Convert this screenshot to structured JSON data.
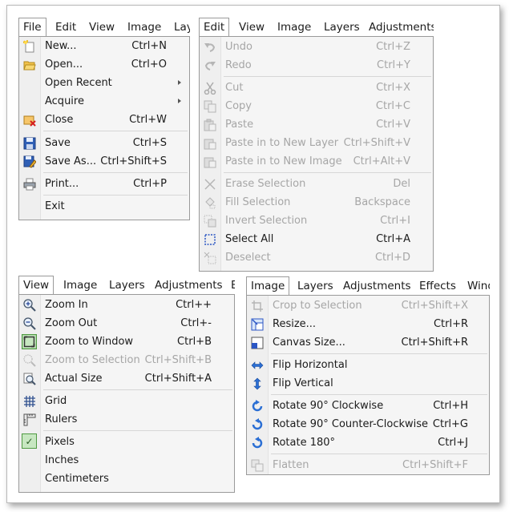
{
  "file_panel": {
    "menubar": [
      "File",
      "Edit",
      "View",
      "Image",
      "Lay"
    ],
    "items": {
      "new": {
        "label": "New...",
        "shortcut": "Ctrl+N"
      },
      "open": {
        "label": "Open...",
        "shortcut": "Ctrl+O"
      },
      "open_recent": {
        "label": "Open Recent"
      },
      "acquire": {
        "label": "Acquire"
      },
      "close": {
        "label": "Close",
        "shortcut": "Ctrl+W"
      },
      "save": {
        "label": "Save",
        "shortcut": "Ctrl+S"
      },
      "save_as": {
        "label": "Save As...",
        "shortcut": "Ctrl+Shift+S"
      },
      "print": {
        "label": "Print...",
        "shortcut": "Ctrl+P"
      },
      "exit": {
        "label": "Exit"
      }
    }
  },
  "edit_panel": {
    "menubar": [
      "Edit",
      "View",
      "Image",
      "Layers",
      "Adjustments"
    ],
    "items": {
      "undo": {
        "label": "Undo",
        "shortcut": "Ctrl+Z"
      },
      "redo": {
        "label": "Redo",
        "shortcut": "Ctrl+Y"
      },
      "cut": {
        "label": "Cut",
        "shortcut": "Ctrl+X"
      },
      "copy": {
        "label": "Copy",
        "shortcut": "Ctrl+C"
      },
      "paste": {
        "label": "Paste",
        "shortcut": "Ctrl+V"
      },
      "paste_new_layer": {
        "label": "Paste in to New Layer",
        "shortcut": "Ctrl+Shift+V"
      },
      "paste_new_image": {
        "label": "Paste in to New Image",
        "shortcut": "Ctrl+Alt+V"
      },
      "erase_selection": {
        "label": "Erase Selection",
        "shortcut": "Del"
      },
      "fill_selection": {
        "label": "Fill Selection",
        "shortcut": "Backspace"
      },
      "invert_selection": {
        "label": "Invert Selection",
        "shortcut": "Ctrl+I"
      },
      "select_all": {
        "label": "Select All",
        "shortcut": "Ctrl+A"
      },
      "deselect": {
        "label": "Deselect",
        "shortcut": "Ctrl+D"
      }
    }
  },
  "view_panel": {
    "menubar": [
      "View",
      "Image",
      "Layers",
      "Adjustments",
      "E"
    ],
    "items": {
      "zoom_in": {
        "label": "Zoom In",
        "shortcut": "Ctrl++"
      },
      "zoom_out": {
        "label": "Zoom Out",
        "shortcut": "Ctrl+-"
      },
      "zoom_window": {
        "label": "Zoom to Window",
        "shortcut": "Ctrl+B"
      },
      "zoom_selection": {
        "label": "Zoom to Selection",
        "shortcut": "Ctrl+Shift+B"
      },
      "actual_size": {
        "label": "Actual Size",
        "shortcut": "Ctrl+Shift+A"
      },
      "grid": {
        "label": "Grid"
      },
      "rulers": {
        "label": "Rulers"
      },
      "pixels": {
        "label": "Pixels",
        "checked": true
      },
      "inches": {
        "label": "Inches"
      },
      "centimeters": {
        "label": "Centimeters"
      }
    }
  },
  "image_panel": {
    "menubar": [
      "Image",
      "Layers",
      "Adjustments",
      "Effects",
      "Wind"
    ],
    "items": {
      "crop": {
        "label": "Crop to Selection",
        "shortcut": "Ctrl+Shift+X"
      },
      "resize": {
        "label": "Resize...",
        "shortcut": "Ctrl+R"
      },
      "canvas_size": {
        "label": "Canvas Size...",
        "shortcut": "Ctrl+Shift+R"
      },
      "flip_h": {
        "label": "Flip Horizontal"
      },
      "flip_v": {
        "label": "Flip Vertical"
      },
      "rot90cw": {
        "label": "Rotate 90° Clockwise",
        "shortcut": "Ctrl+H"
      },
      "rot90ccw": {
        "label": "Rotate 90° Counter-Clockwise",
        "shortcut": "Ctrl+G"
      },
      "rot180": {
        "label": "Rotate 180°",
        "shortcut": "Ctrl+J"
      },
      "flatten": {
        "label": "Flatten",
        "shortcut": "Ctrl+Shift+F"
      }
    }
  }
}
